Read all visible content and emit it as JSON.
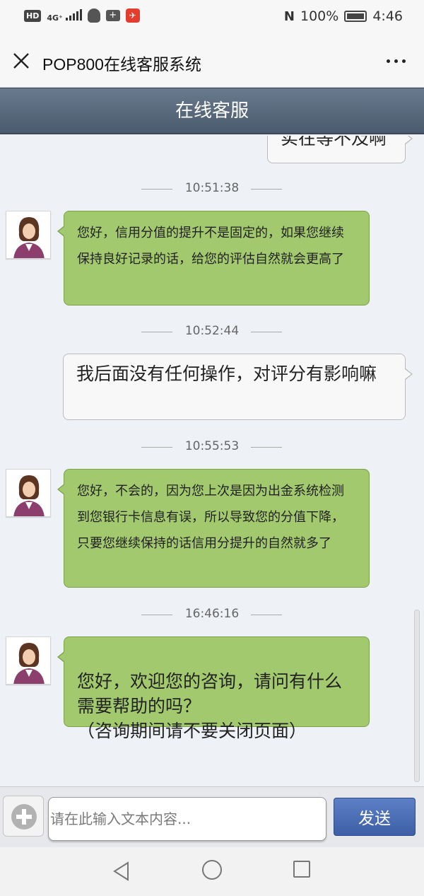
{
  "status_bar": {
    "hd_label": "HD",
    "signal_label": "4G⁺",
    "nfc_label": "N",
    "battery": "100%",
    "time": "4:46",
    "icons": [
      "hd-icon",
      "signal-icon",
      "qq-icon",
      "notification-icon",
      "app-icon",
      "nfc-icon",
      "battery-icon"
    ]
  },
  "header": {
    "title": "POP800在线客服系统",
    "close_icon": "close-icon",
    "more_icon": "more-icon"
  },
  "service_bar": {
    "title": "在线客服"
  },
  "chat": {
    "partial_user_message": "实在等不及啊",
    "messages": [
      {
        "time": "10:51:38",
        "sender": "agent",
        "text": "您好，信用分值的提升不是固定的，如果您继续保持良好记录的话，给您的评估自然就会更高了"
      },
      {
        "time": "10:52:44",
        "sender": "user",
        "text": "我后面没有任何操作，对评分有影响嘛"
      },
      {
        "time": "10:55:53",
        "sender": "agent",
        "text": "您好，不会的，因为您上次是因为出金系统检测到您银行卡信息有误，所以导致您的分值下降，只要您继续保持的话信用分提升的自然就多了"
      },
      {
        "time": "16:46:16",
        "sender": "agent",
        "text": "您好，欢迎您的咨询，请问有什么需要帮助的吗？\n（咨询期间请不要关闭页面）"
      }
    ]
  },
  "input_bar": {
    "value": "",
    "placeholder": "请在此输入文本内容...",
    "send_label": "发送",
    "plus_icon": "plus-icon"
  },
  "nav_bar": {
    "icons": [
      "back-icon",
      "home-icon",
      "recent-apps-icon"
    ]
  },
  "colors": {
    "agent_bubble": "#a2c96d",
    "user_bubble": "#f8f8f8",
    "service_bar": "#5a6a7e",
    "send_button": "#4a6db5",
    "chat_background": "#eef1f6"
  }
}
